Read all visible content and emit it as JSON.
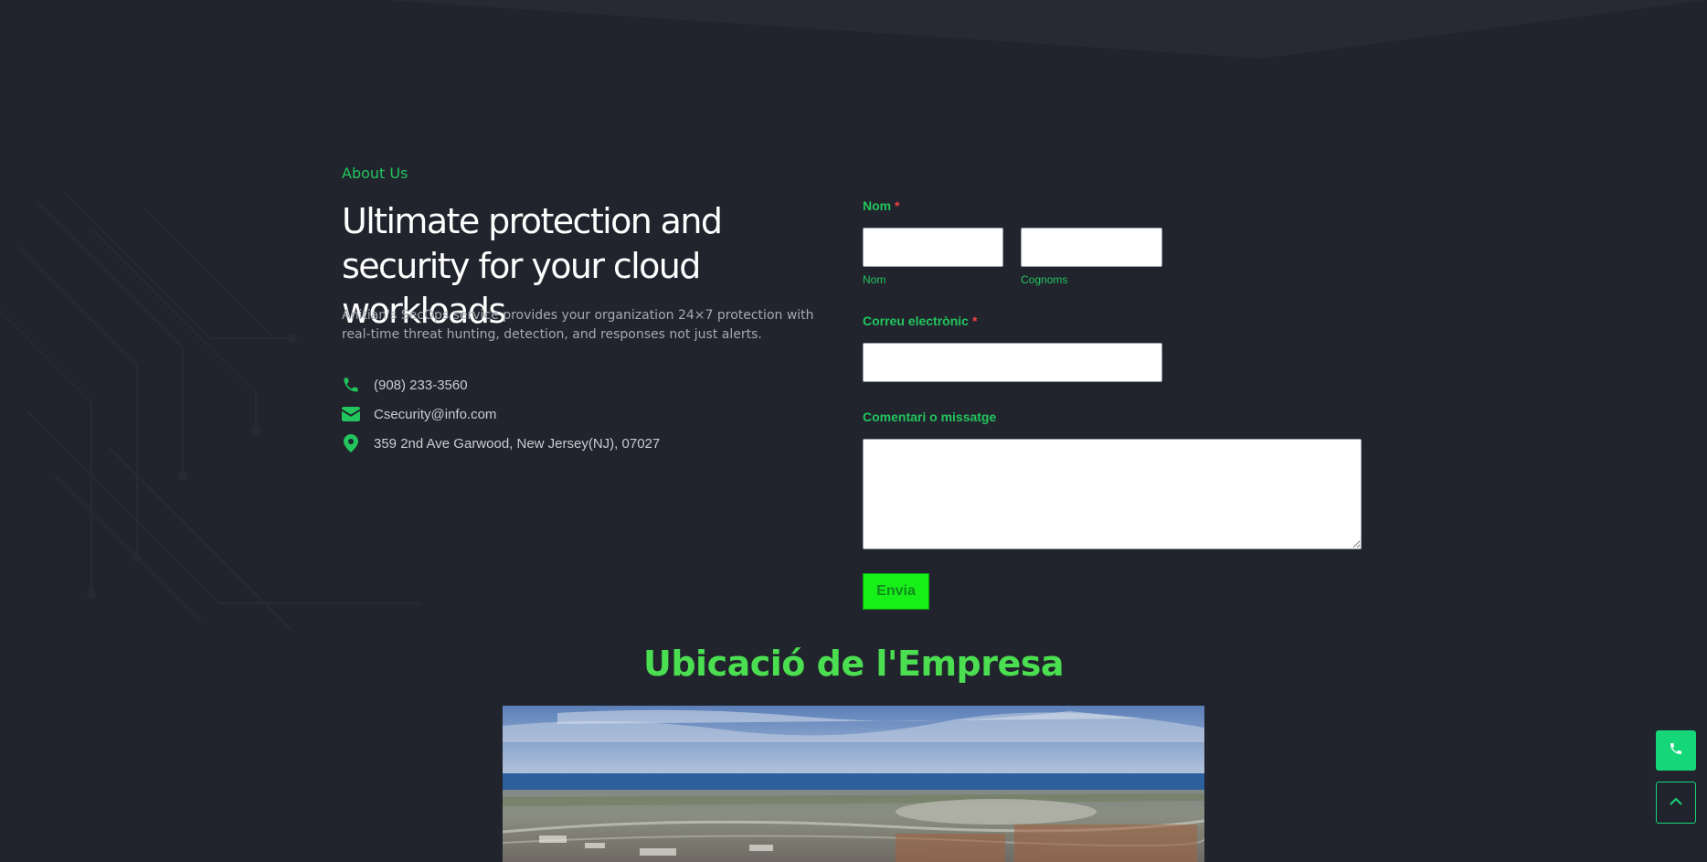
{
  "about": {
    "label": "About Us",
    "headline": "Ultimate protection and security for your cloud workloads",
    "description": "Anitian's SecOps service provides your organization 24×7 protection with real-time threat hunting, detection, and responses not just alerts."
  },
  "contacts": [
    {
      "icon": "phone-icon",
      "text": "(908) 233-3560"
    },
    {
      "icon": "envelope-icon",
      "text": "Csecurity@info.com"
    },
    {
      "icon": "map-pin-icon",
      "text": "359 2nd Ave Garwood, New Jersey(NJ), 07027"
    }
  ],
  "form": {
    "name_label": "Nom",
    "required_mark": "*",
    "first_name_sublabel": "Nom",
    "last_name_sublabel": "Cognoms",
    "first_name_value": "",
    "last_name_value": "",
    "email_label": "Correu electrònic",
    "email_value": "",
    "message_label": "Comentari o missatge",
    "message_value": "",
    "submit_label": "Envia"
  },
  "location": {
    "title": "Ubicació de l'Empresa"
  },
  "floating": {
    "call_icon": "phone-icon",
    "top_icon": "chevron-up-icon"
  },
  "colors": {
    "background": "#21242c",
    "accent": "#22c55e",
    "submit_button": "#16f018",
    "floating_button": "#16d67a",
    "required": "#ef4444"
  }
}
